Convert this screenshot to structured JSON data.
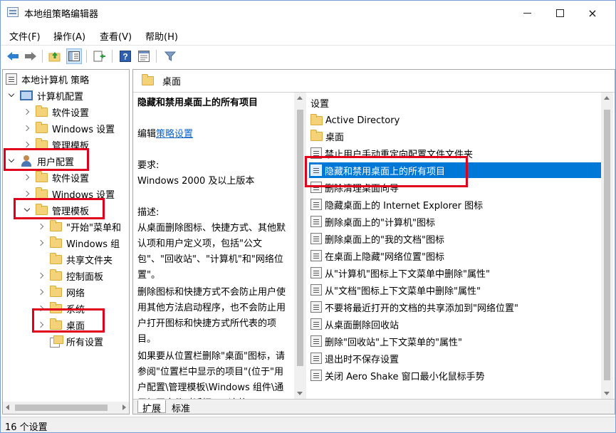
{
  "window": {
    "title": "本地组策略编辑器",
    "buttons": {
      "minimize": "minimize",
      "maximize": "maximize",
      "close": "×"
    }
  },
  "menu": [
    "文件(F)",
    "操作(A)",
    "查看(V)",
    "帮助(H)"
  ],
  "toolbar": {
    "icons": [
      "back-arrow-icon",
      "forward-arrow-icon",
      "up-folder-icon",
      "show-hide-tree-icon",
      "export-list-icon",
      "help-icon",
      "properties-icon",
      "filter-icon"
    ]
  },
  "tree": {
    "root": "本地计算机 策略",
    "computer_config": "计算机配置",
    "computer_children": [
      "软件设置",
      "Windows 设置",
      "管理模板"
    ],
    "user_config": "用户配置",
    "user_children": [
      "软件设置",
      "Windows 设置"
    ],
    "admin_templates": "管理模板",
    "admin_children": [
      "\"开始\"菜单和",
      "Windows 组",
      "共享文件夹",
      "控制面板",
      "网络",
      "系统"
    ],
    "desktop": "桌面",
    "all_settings": "所有设置"
  },
  "right": {
    "header_title": "桌面",
    "description": {
      "title": "隐藏和禁用桌面上的所有项目",
      "edit_prefix": "编辑",
      "edit_link": "策略设置",
      "req_label": "要求:",
      "req_value": "Windows 2000 及以上版本",
      "desc_label": "描述:",
      "para1": "从桌面删除图标、快捷方式、其他默认项和用户定义项，包括\"公文包\"、\"回收站\"、\"计算机\"和\"网络位置\"。",
      "para2": "删除图标和快捷方式不会防止用户使用其他方法启动程序，也不会防止用户打开图标和快捷方式所代表的项目。",
      "para3": "如果要从位置栏删除\"桌面\"图标，请参阅\"位置栏中显示的项目\"(位于\"用户配置\\管理模板\\Windows 组件\\通用打开文件对话框\")。这将"
    },
    "list_header": "设置",
    "folders": [
      "Active Directory",
      "桌面"
    ],
    "items": [
      "禁止用户手动重定向配置文件文件夹",
      "隐藏和禁用桌面上的所有项目",
      "删除清理桌面向导",
      "隐藏桌面上的 Internet Explorer 图标",
      "删除桌面上的\"计算机\"图标",
      "删除桌面上的\"我的文档\"图标",
      "在桌面上隐藏\"网络位置\"图标",
      "从\"计算机\"图标上下文菜单中删除\"属性\"",
      "从\"文档\"图标上下文菜单中删除\"属性\"",
      "不要将最近打开的文档的共享添加到\"网络位置\"",
      "从桌面删除回收站",
      "删除\"回收站\"上下文菜单的\"属性\"",
      "退出时不保存设置",
      "关闭 Aero Shake 窗口最小化鼠标手势"
    ],
    "selected_index": 1,
    "tabs": [
      "扩展",
      "标准"
    ]
  },
  "status": "16 个设置",
  "colors": {
    "highlight_box": "#e0001b",
    "selection": "#0078d7",
    "link": "#0a64c8"
  }
}
